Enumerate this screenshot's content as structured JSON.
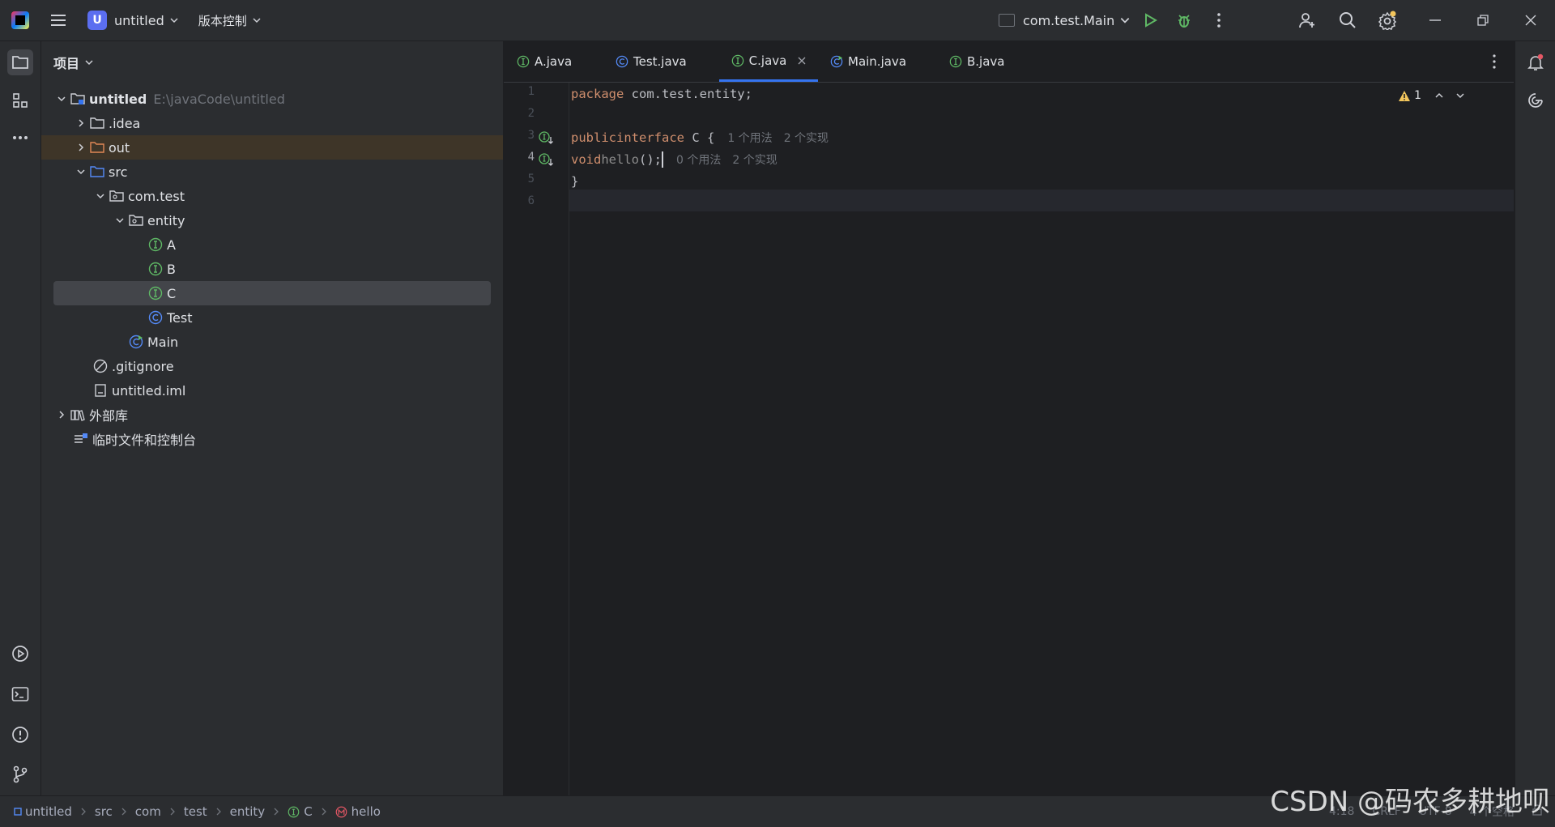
{
  "titlebar": {
    "project_badge": "U",
    "project_name": "untitled",
    "vcs_label": "版本控制",
    "run_config": "com.test.Main"
  },
  "project_panel": {
    "title": "项目",
    "tree": [
      {
        "label": "untitled",
        "path": "E:\\javaCode\\untitled"
      },
      {
        "label": ".idea"
      },
      {
        "label": "out"
      },
      {
        "label": "src"
      },
      {
        "label": "com.test"
      },
      {
        "label": "entity"
      },
      {
        "label": "A"
      },
      {
        "label": "B"
      },
      {
        "label": "C"
      },
      {
        "label": "Test"
      },
      {
        "label": "Main"
      },
      {
        "label": ".gitignore"
      },
      {
        "label": "untitled.iml"
      },
      {
        "label": "外部库"
      },
      {
        "label": "临时文件和控制台"
      }
    ]
  },
  "editor": {
    "tabs": [
      {
        "label": "A.java"
      },
      {
        "label": "Test.java"
      },
      {
        "label": "C.java"
      },
      {
        "label": "Main.java"
      },
      {
        "label": "B.java"
      }
    ],
    "line_numbers": [
      "1",
      "2",
      "3",
      "4",
      "5",
      "6"
    ],
    "code": {
      "l1_kw": "package",
      "l1_rest": " com.test.entity;",
      "l3_kw1": "public",
      "l3_kw2": "interface",
      "l3_rest": " C {",
      "l3_hint_usages": "1 个用法",
      "l3_hint_impls": "2 个实现",
      "l4_kw": "void",
      "l4_fn": "hello",
      "l4_rest": "();",
      "l4_hint_usages": "0 个用法",
      "l4_hint_impls": "2 个实现",
      "l5": "}"
    },
    "warnings_count": "1"
  },
  "statusbar": {
    "breadcrumbs": [
      "untitled",
      "src",
      "com",
      "test",
      "entity",
      "C",
      "hello"
    ],
    "position": "4:18",
    "line_sep": "CRLF",
    "encoding": "UTF-8",
    "indent": "4 个空格"
  },
  "watermark": "CSDN @码农多耕地呗",
  "colors": {
    "interface_icon": "#5fb865",
    "class_icon": "#548af7",
    "accent": "#3574f0",
    "keyword": "#cf8e6d"
  }
}
